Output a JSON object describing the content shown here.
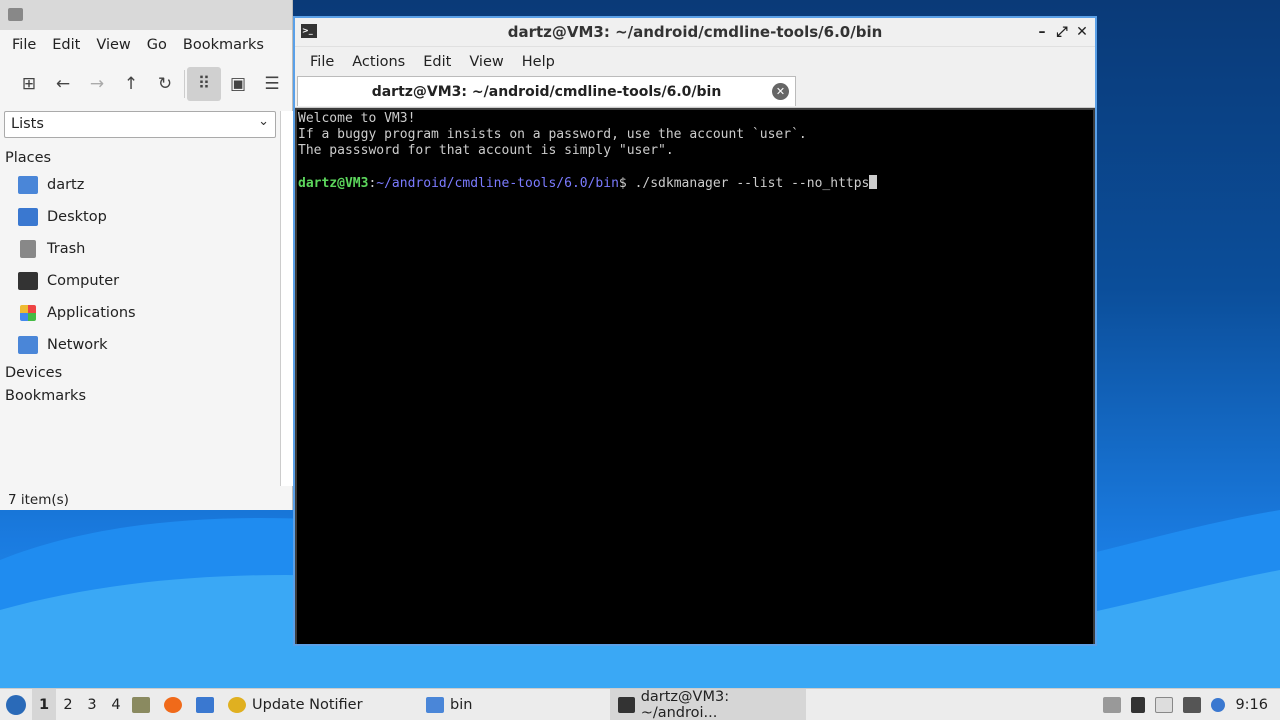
{
  "file_manager": {
    "title": "bin",
    "menu": [
      "File",
      "Edit",
      "View",
      "Go",
      "Bookmarks"
    ],
    "side_pane_mode": "Lists",
    "places_header": "Places",
    "places": [
      "dartz",
      "Desktop",
      "Trash",
      "Computer",
      "Applications",
      "Network"
    ],
    "devices_header": "Devices",
    "bookmarks_header": "Bookmarks",
    "status": "7 item(s)"
  },
  "terminal": {
    "title": "dartz@VM3: ~/android/cmdline-tools/6.0/bin",
    "menu": [
      "File",
      "Actions",
      "Edit",
      "View",
      "Help"
    ],
    "tab_label": "dartz@VM3: ~/android/cmdline-tools/6.0/bin",
    "lines": [
      "Welcome to VM3!",
      "If a buggy program insists on a password, use the account `user`.",
      "The passsword for that account is simply \"user\"."
    ],
    "prompt_user": "dartz@VM3",
    "prompt_sep": ":",
    "prompt_path": "~/android/cmdline-tools/6.0/bin",
    "prompt_command": "$ ./sdkmanager --list --no_https"
  },
  "taskbar": {
    "workspaces": [
      "1",
      "2",
      "3",
      "4"
    ],
    "tasks": [
      "Update Notifier",
      "bin",
      "dartz@VM3: ~/androi..."
    ],
    "clock": "9:16"
  }
}
